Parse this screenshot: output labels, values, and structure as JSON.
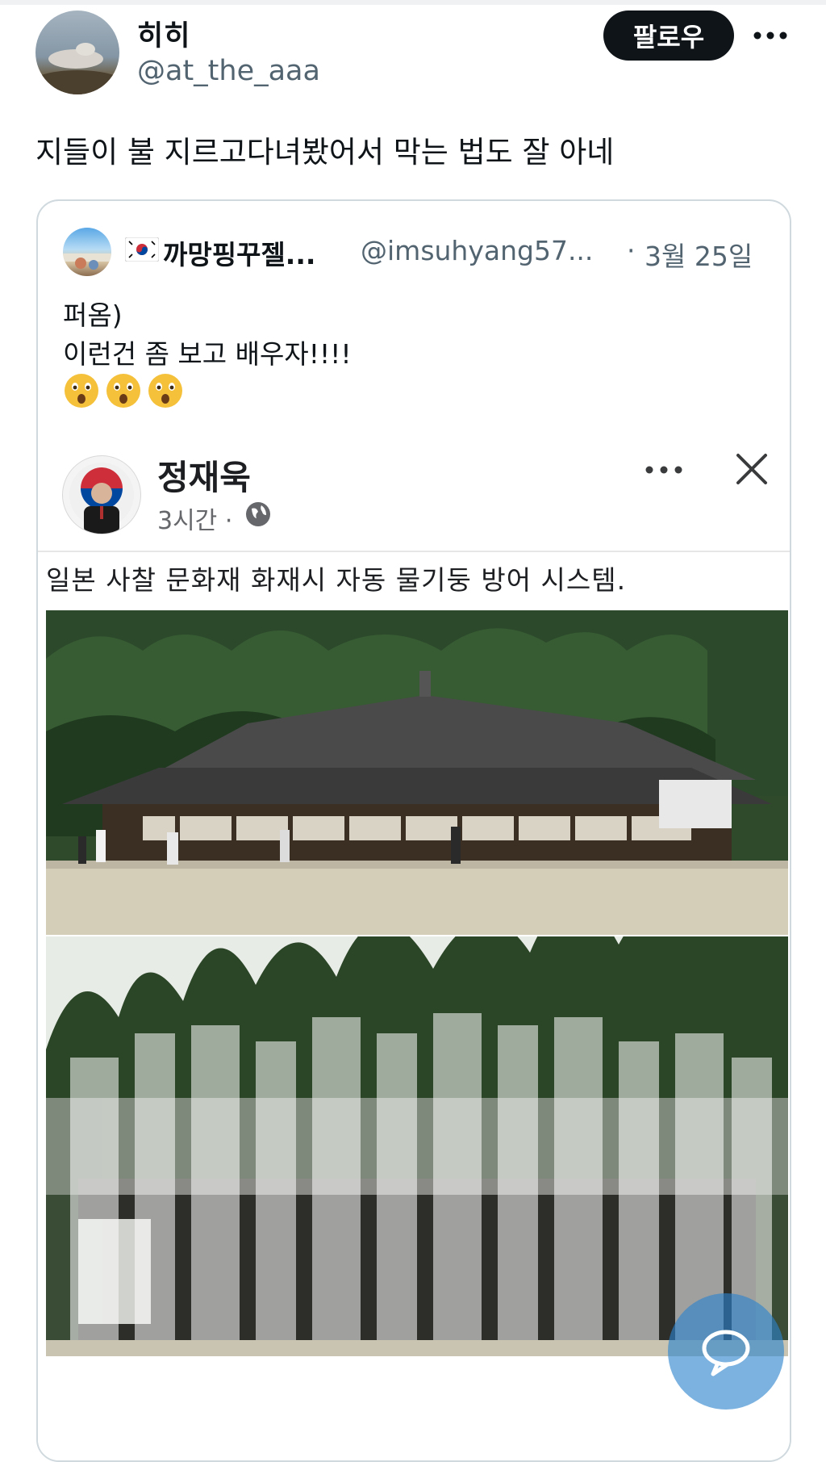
{
  "tweet": {
    "author_name": "히히",
    "author_handle": "@at_the_aaa",
    "follow_label": "팔로우",
    "text": "지들이 불 지르고다녀봤어서 막는 법도 잘 아네"
  },
  "quoted": {
    "author_name": "까망핑꾸젤...",
    "author_handle": "@imsuhyang57...",
    "dot": "·",
    "date": "3월 25일",
    "lines": [
      "퍼옴)",
      "이런건 좀 보고 배우자!!!!"
    ]
  },
  "facebook_post": {
    "author_name": "정재욱",
    "time": "3시간 ·",
    "text": "일본 사찰 문화재 화재시 자동 물기둥 방어 시스템."
  },
  "icons": {
    "more": "more-horizontal-icon",
    "flag": "korea-flag-icon",
    "emoji": "astonished-face-emoji",
    "globe": "globe-icon",
    "close": "close-icon",
    "reply": "chat-bubble-icon"
  },
  "colors": {
    "text_primary": "#0f1419",
    "text_secondary": "#536471",
    "border": "#cfd9de",
    "fab": "#2b82cd"
  }
}
